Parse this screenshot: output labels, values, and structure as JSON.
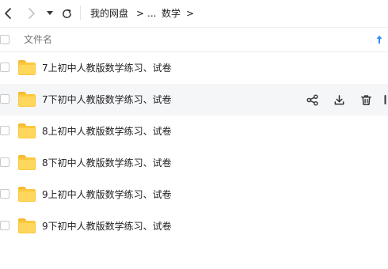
{
  "breadcrumb": {
    "items": [
      "我的网盘",
      "...",
      "数学"
    ],
    "separator": ">"
  },
  "list": {
    "header_label": "文件名",
    "files": [
      {
        "name": "7上初中人教版数学练习、试卷"
      },
      {
        "name": "7下初中人教版数学练习、试卷"
      },
      {
        "name": "8上初中人教版数学练习、试卷"
      },
      {
        "name": "8下初中人教版数学练习、试卷"
      },
      {
        "name": "9上初中人教版数学练习、试卷"
      },
      {
        "name": "9下初中人教版数学练习、试卷"
      }
    ]
  },
  "icons": {
    "back": "back-arrow-icon",
    "forward": "forward-arrow-icon",
    "dropdown": "caret-down-icon",
    "refresh": "refresh-icon",
    "sort": "sort-arrow-up-icon",
    "folder": "folder-icon",
    "share": "share-icon",
    "download": "download-icon",
    "delete": "trash-icon"
  },
  "colors": {
    "accent": "#2f8cff",
    "folder": "#fcc83d",
    "hover_row": "#f5f6f8"
  }
}
